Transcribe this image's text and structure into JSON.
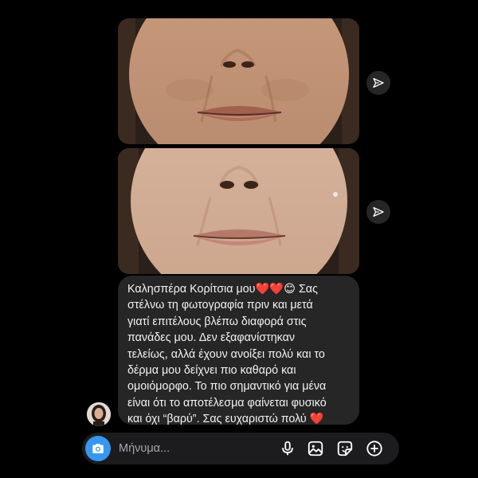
{
  "attachments": [
    {
      "label": "photo-before"
    },
    {
      "label": "photo-after"
    }
  ],
  "message": {
    "lines": [
      "Καλησπέρα Κορίτσια μου❤️❤️😊 Σας",
      "στέλνω τη φωτογραφία πριν και μετά",
      "γιατί επιτέλους βλέπω διαφορά στις",
      "πανάδες μου. Δεν εξαφανίστηκαν",
      "τελείως, αλλά έχουν ανοίξει πολύ και το",
      "δέρμα μου δείχνει πιο καθαρό και",
      "ομοιόμορφο. Το πιο σημαντικό για μένα",
      "είναι ότι το αποτέλεσμα φαίνεται φυσικό",
      "και όχι “βαρύ”. Σας ευχαριστώ πολύ ❤️"
    ]
  },
  "composer": {
    "placeholder": "Μήνυμα...",
    "icons": [
      "camera-icon",
      "microphone-icon",
      "gallery-icon",
      "sticker-icon",
      "plus-icon"
    ]
  },
  "colors": {
    "background": "#000000",
    "bubble": "#262626",
    "composer": "#1c1c1e",
    "camera_button": "#3797f0",
    "text": "#f2f2f2",
    "icon": "#ffffff"
  }
}
